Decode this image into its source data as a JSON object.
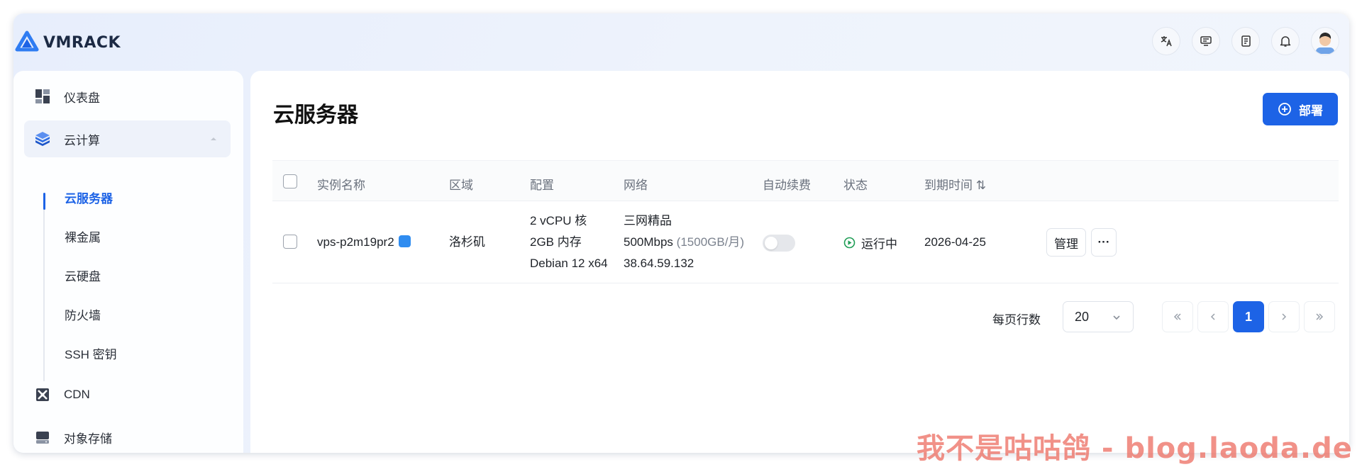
{
  "brand": {
    "name": "VMRACK"
  },
  "sidebar": {
    "items": [
      {
        "label": "仪表盘",
        "icon": "dashboard-icon"
      },
      {
        "label": "云计算",
        "icon": "cube-icon"
      },
      {
        "label": "CDN",
        "icon": "cdn-icon"
      },
      {
        "label": "对象存储",
        "icon": "storage-icon"
      }
    ],
    "sub_items": [
      "云服务器",
      "裸金属",
      "云硬盘",
      "防火墙",
      "SSH 密钥"
    ]
  },
  "main": {
    "title": "云服务器",
    "deploy_label": "部署",
    "columns": [
      "实例名称",
      "区域",
      "配置",
      "网络",
      "自动续费",
      "状态",
      "到期时间 ⇅"
    ],
    "rows": [
      {
        "name": "vps-p2m19pr2",
        "region": "洛杉矶",
        "config": [
          "2 vCPU 核",
          "2GB 内存",
          "Debian 12 x64"
        ],
        "network_line1": "三网精品",
        "network_speed": "500Mbps",
        "network_quota": "(1500GB/月)",
        "ip": "38.64.59.132",
        "auto_renew": false,
        "status": "运行中",
        "expiry": "2026-04-25",
        "manage_label": "管理",
        "more_label": "···"
      }
    ],
    "pagination": {
      "rows_per_page_label": "每页行数",
      "rows_per_page": "20",
      "current_page": "1"
    }
  },
  "colors": {
    "accent": "#1d63e6",
    "status_running": "#1f9d55"
  },
  "watermark": "我不是咕咕鸽 - blog.laoda.de"
}
